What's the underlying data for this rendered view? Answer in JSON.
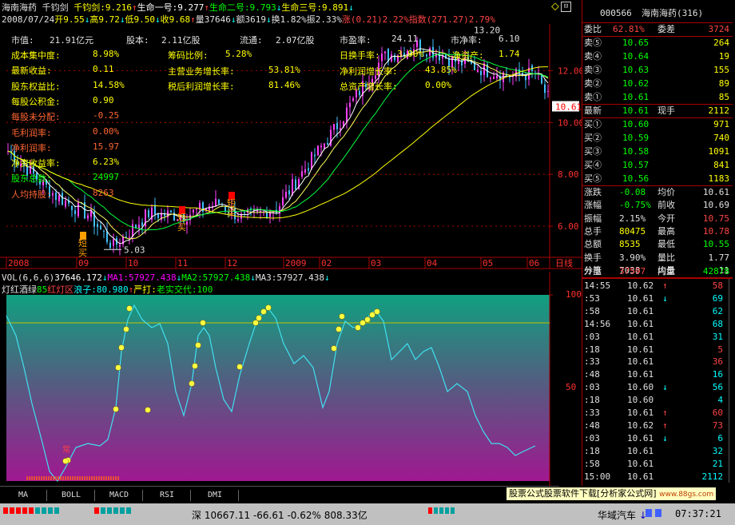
{
  "header": {
    "stock_name": "海南海药",
    "indicator_name": "千钧剑",
    "line0": [
      {
        "t": "千钧剑:9.216",
        "c": "#ffff00"
      },
      {
        "t": "↑",
        "c": "#ff4444"
      },
      {
        "t": "生命一号:9.277",
        "c": "#ffffff"
      },
      {
        "t": "↑",
        "c": "#ff4444"
      },
      {
        "t": "生命二号:9.793",
        "c": "#00ff00"
      },
      {
        "t": "↓",
        "c": "#00ffff"
      },
      {
        "t": "生命三号:9.891",
        "c": "#ffff00"
      },
      {
        "t": "↓",
        "c": "#00ffff"
      }
    ],
    "line1": [
      {
        "t": "2008/07/24",
        "c": "#e0e0e0"
      },
      {
        "t": "开9.55",
        "c": "#ffff00"
      },
      {
        "t": "↓",
        "c": "#00ffff"
      },
      {
        "t": "高9.72",
        "c": "#ffff00"
      },
      {
        "t": "↓",
        "c": "#00ffff"
      },
      {
        "t": "低9.50",
        "c": "#ffff00"
      },
      {
        "t": "↓",
        "c": "#00ffff"
      },
      {
        "t": "收9.68",
        "c": "#ffff00"
      },
      {
        "t": "↑",
        "c": "#ff4444"
      },
      {
        "t": "量37646",
        "c": "#e0e0e0"
      },
      {
        "t": "↓",
        "c": "#00ffff"
      },
      {
        "t": "额3619",
        "c": "#e0e0e0"
      },
      {
        "t": "↓",
        "c": "#00ffff"
      },
      {
        "t": "换1.82%",
        "c": "#e0e0e0"
      },
      {
        "t": "振2.33%",
        "c": "#e0e0e0"
      },
      {
        "t": "涨(0.21)2.22%",
        "c": "#ff4444"
      },
      {
        "t": "指数(271.27)2.79%",
        "c": "#ff4444"
      }
    ]
  },
  "fundamentals": {
    "top_row": [
      {
        "label": "市值:",
        "value": "21.91亿元"
      },
      {
        "label": "股本:",
        "value": "2.11亿股"
      },
      {
        "label": "流通:",
        "value": "2.07亿股"
      },
      {
        "label": "市盈率:",
        "value": "24.11"
      },
      {
        "label": "市净率:",
        "value": "6.10"
      }
    ],
    "left": [
      {
        "label": "成本集中度:",
        "value": "8.98%",
        "color": "#ffff00"
      },
      {
        "label": "最新收益:",
        "value": "0.11",
        "color": "#ffff00"
      },
      {
        "label": "股东权益比:",
        "value": "14.58%",
        "color": "#ffff00"
      },
      {
        "label": "每股公积金:",
        "value": "0.90",
        "color": "#ffff00"
      },
      {
        "label": "每股未分配:",
        "value": "-0.25",
        "color": "#ff6633"
      },
      {
        "label": "毛利润率:",
        "value": "0.00%",
        "color": "#ff6633"
      },
      {
        "label": "净利润率:",
        "value": "15.97",
        "color": "#ff6633"
      },
      {
        "label": "净资收益率:",
        "value": "6.23%",
        "color": "#ffff00"
      },
      {
        "label": "股东总数:",
        "value": "24997",
        "color": "#00ff00"
      },
      {
        "label": "人均持股:",
        "value": "8263",
        "color": "#ff6633"
      }
    ],
    "mid": [
      {
        "label": "筹码比例:",
        "value": "5.28%"
      },
      {
        "label": "主营业务增长率:",
        "value": "53.81%"
      },
      {
        "label": "税后利润增长率:",
        "value": "81.46%"
      }
    ],
    "right": [
      {
        "label": "日换手率:",
        "value": "3.90%"
      },
      {
        "label": "净利润增长率:",
        "value": "43.85%"
      },
      {
        "label": "总资产增长率:",
        "value": "0.00%"
      }
    ],
    "extra_label": "净资产:",
    "extra_value": "1.74"
  },
  "chart_data": {
    "type": "candlestick",
    "y_ticks": [
      "12.00",
      "10.00",
      "8.00",
      "6.00"
    ],
    "high_label": "13.20",
    "low_label": "5.03",
    "last_price_tag": "10.61",
    "x_labels": [
      "2008",
      "09",
      "10",
      "11",
      "12",
      "2009",
      "02",
      "03",
      "04",
      "05",
      "06"
    ],
    "signals": [
      "短",
      "买",
      "短",
      "买",
      "短",
      "买",
      "短",
      "买"
    ],
    "axis_unit": "日线",
    "ylim": [
      4.8,
      13.8
    ]
  },
  "indicator": {
    "vol_line": [
      {
        "t": "VOL(6,6,6)",
        "c": "#e0e0e0"
      },
      {
        "t": "37646.172",
        "c": "#ffffff"
      },
      {
        "t": "↓",
        "c": "#00ffff"
      },
      {
        "t": "MA1:57927.438",
        "c": "#ff00ff"
      },
      {
        "t": "↓",
        "c": "#00ffff"
      },
      {
        "t": "MA2:57927.438",
        "c": "#00ff00"
      },
      {
        "t": "↓",
        "c": "#00ffff"
      },
      {
        "t": "MA3:57927.438",
        "c": "#e0e0e0"
      },
      {
        "t": "↓",
        "c": "#00ffff"
      }
    ],
    "sub_line": [
      {
        "t": "灯红酒绿",
        "c": "#e0e0e0"
      },
      {
        "t": "85",
        "c": "#00ff00"
      },
      {
        "t": "红灯区",
        "c": "#ff4444"
      },
      {
        "t": "浪子:80.980",
        "c": "#00ffff"
      },
      {
        "t": "↑",
        "c": "#ff4444"
      },
      {
        "t": "严打",
        "c": "#ffff00"
      },
      {
        "t": ":",
        "c": "#ffff00"
      },
      {
        "t": "老实交代:100",
        "c": "#00ff00"
      }
    ],
    "y_top": "100",
    "y_mid": "50",
    "marker": "常"
  },
  "quote_panel": {
    "code": "000566",
    "name": "海南海药(316)",
    "weibi_label": "委比",
    "weibi_value": "62.81%",
    "weicha_label": "委差",
    "weicha_value": "3724",
    "sells": [
      {
        "label": "卖⑤",
        "price": "10.65",
        "vol": "264"
      },
      {
        "label": "卖④",
        "price": "10.64",
        "vol": "19"
      },
      {
        "label": "卖③",
        "price": "10.63",
        "vol": "155"
      },
      {
        "label": "卖②",
        "price": "10.62",
        "vol": "89"
      },
      {
        "label": "卖①",
        "price": "10.61",
        "vol": "85"
      }
    ],
    "latest_label": "最新",
    "latest_value": "10.61",
    "xianshou_label": "现手",
    "xianshou_value": "2112",
    "buys": [
      {
        "label": "买①",
        "price": "10.60",
        "vol": "971"
      },
      {
        "label": "买②",
        "price": "10.59",
        "vol": "740"
      },
      {
        "label": "买③",
        "price": "10.58",
        "vol": "1091"
      },
      {
        "label": "买④",
        "price": "10.57",
        "vol": "841"
      },
      {
        "label": "买⑤",
        "price": "10.56",
        "vol": "1183"
      }
    ],
    "stats": [
      {
        "l1": "涨跌",
        "v1": "-0.08",
        "c1": "#00ff00",
        "l2": "均价",
        "v2": "10.61",
        "c2": "#e0e0e0"
      },
      {
        "l1": "涨幅",
        "v1": "-0.75%",
        "c1": "#00ff00",
        "l2": "前收",
        "v2": "10.69",
        "c2": "#e0e0e0"
      },
      {
        "l1": "振幅",
        "v1": "2.15%",
        "c1": "#e0e0e0",
        "l2": "今开",
        "v2": "10.75",
        "c2": "#ff4444"
      },
      {
        "l1": "总手",
        "v1": "80475",
        "c1": "#ffff00",
        "l2": "最高",
        "v2": "10.78",
        "c2": "#ff4444"
      },
      {
        "l1": "总额",
        "v1": "8535",
        "c1": "#ffff00",
        "l2": "最低",
        "v2": "10.55",
        "c2": "#00ff00"
      },
      {
        "l1": "换手",
        "v1": "3.90%",
        "c1": "#e0e0e0",
        "l2": "量比",
        "v2": "1.77",
        "c2": "#e0e0e0"
      },
      {
        "l1": "分笔",
        "v1": "7038",
        "c1": "#e0e0e0",
        "l2": "均量",
        "v2": "11",
        "c2": "#e0e0e0"
      }
    ],
    "waipan_label": "外盘",
    "waipan_value": "37597",
    "neipan_label": "内盘",
    "neipan_value": "42878",
    "ticks": [
      {
        "t": "14:55",
        "p": "10.62",
        "a": "↑",
        "ac": "#ff4444",
        "v": "58",
        "vc": "#ff4444"
      },
      {
        "t": ":53",
        "p": "10.61",
        "a": "↓",
        "ac": "#00ffff",
        "v": "69",
        "vc": "#00ffff"
      },
      {
        "t": ":58",
        "p": "10.61",
        "a": "",
        "ac": "#e0e0e0",
        "v": "62",
        "vc": "#00ffff"
      },
      {
        "t": "14:56",
        "p": "10.61",
        "a": "",
        "ac": "#e0e0e0",
        "v": "68",
        "vc": "#00ffff"
      },
      {
        "t": ":03",
        "p": "10.61",
        "a": "",
        "ac": "#e0e0e0",
        "v": "31",
        "vc": "#00ffff"
      },
      {
        "t": ":18",
        "p": "10.61",
        "a": "",
        "ac": "#e0e0e0",
        "v": "5",
        "vc": "#ff4444"
      },
      {
        "t": ":33",
        "p": "10.61",
        "a": "",
        "ac": "#e0e0e0",
        "v": "36",
        "vc": "#ff4444"
      },
      {
        "t": ":48",
        "p": "10.61",
        "a": "",
        "ac": "#e0e0e0",
        "v": "16",
        "vc": "#00ffff"
      },
      {
        "t": ":03",
        "p": "10.60",
        "a": "↓",
        "ac": "#00ffff",
        "v": "56",
        "vc": "#00ffff"
      },
      {
        "t": ":18",
        "p": "10.60",
        "a": "",
        "ac": "#e0e0e0",
        "v": "4",
        "vc": "#00ffff"
      },
      {
        "t": ":33",
        "p": "10.61",
        "a": "↑",
        "ac": "#ff4444",
        "v": "60",
        "vc": "#ff4444"
      },
      {
        "t": ":48",
        "p": "10.62",
        "a": "↑",
        "ac": "#ff4444",
        "v": "73",
        "vc": "#ff4444"
      },
      {
        "t": ":03",
        "p": "10.61",
        "a": "↓",
        "ac": "#00ffff",
        "v": "6",
        "vc": "#00ffff"
      },
      {
        "t": ":18",
        "p": "10.61",
        "a": "",
        "ac": "#e0e0e0",
        "v": "32",
        "vc": "#00ffff"
      },
      {
        "t": ":58",
        "p": "10.61",
        "a": "",
        "ac": "#e0e0e0",
        "v": "21",
        "vc": "#00ffff"
      },
      {
        "t": "15:00",
        "p": "10.61",
        "a": "",
        "ac": "#e0e0e0",
        "v": "2112",
        "vc": "#00ffff"
      }
    ]
  },
  "tabs": [
    "MA",
    "BOLL",
    "MACD",
    "RSI",
    "DMI"
  ],
  "status": {
    "index_name": "深",
    "index_value": "10667.11",
    "index_change": "-66.61",
    "index_pct": "-0.62%",
    "turnover": "808.33亿",
    "ad_banner": "股票公式股票软件下载[分析家公式网]",
    "ad_url": "www.88gs.com",
    "ticker": "华域汽车",
    "ticker_arrow": "↓",
    "clock": "07:37:21"
  }
}
